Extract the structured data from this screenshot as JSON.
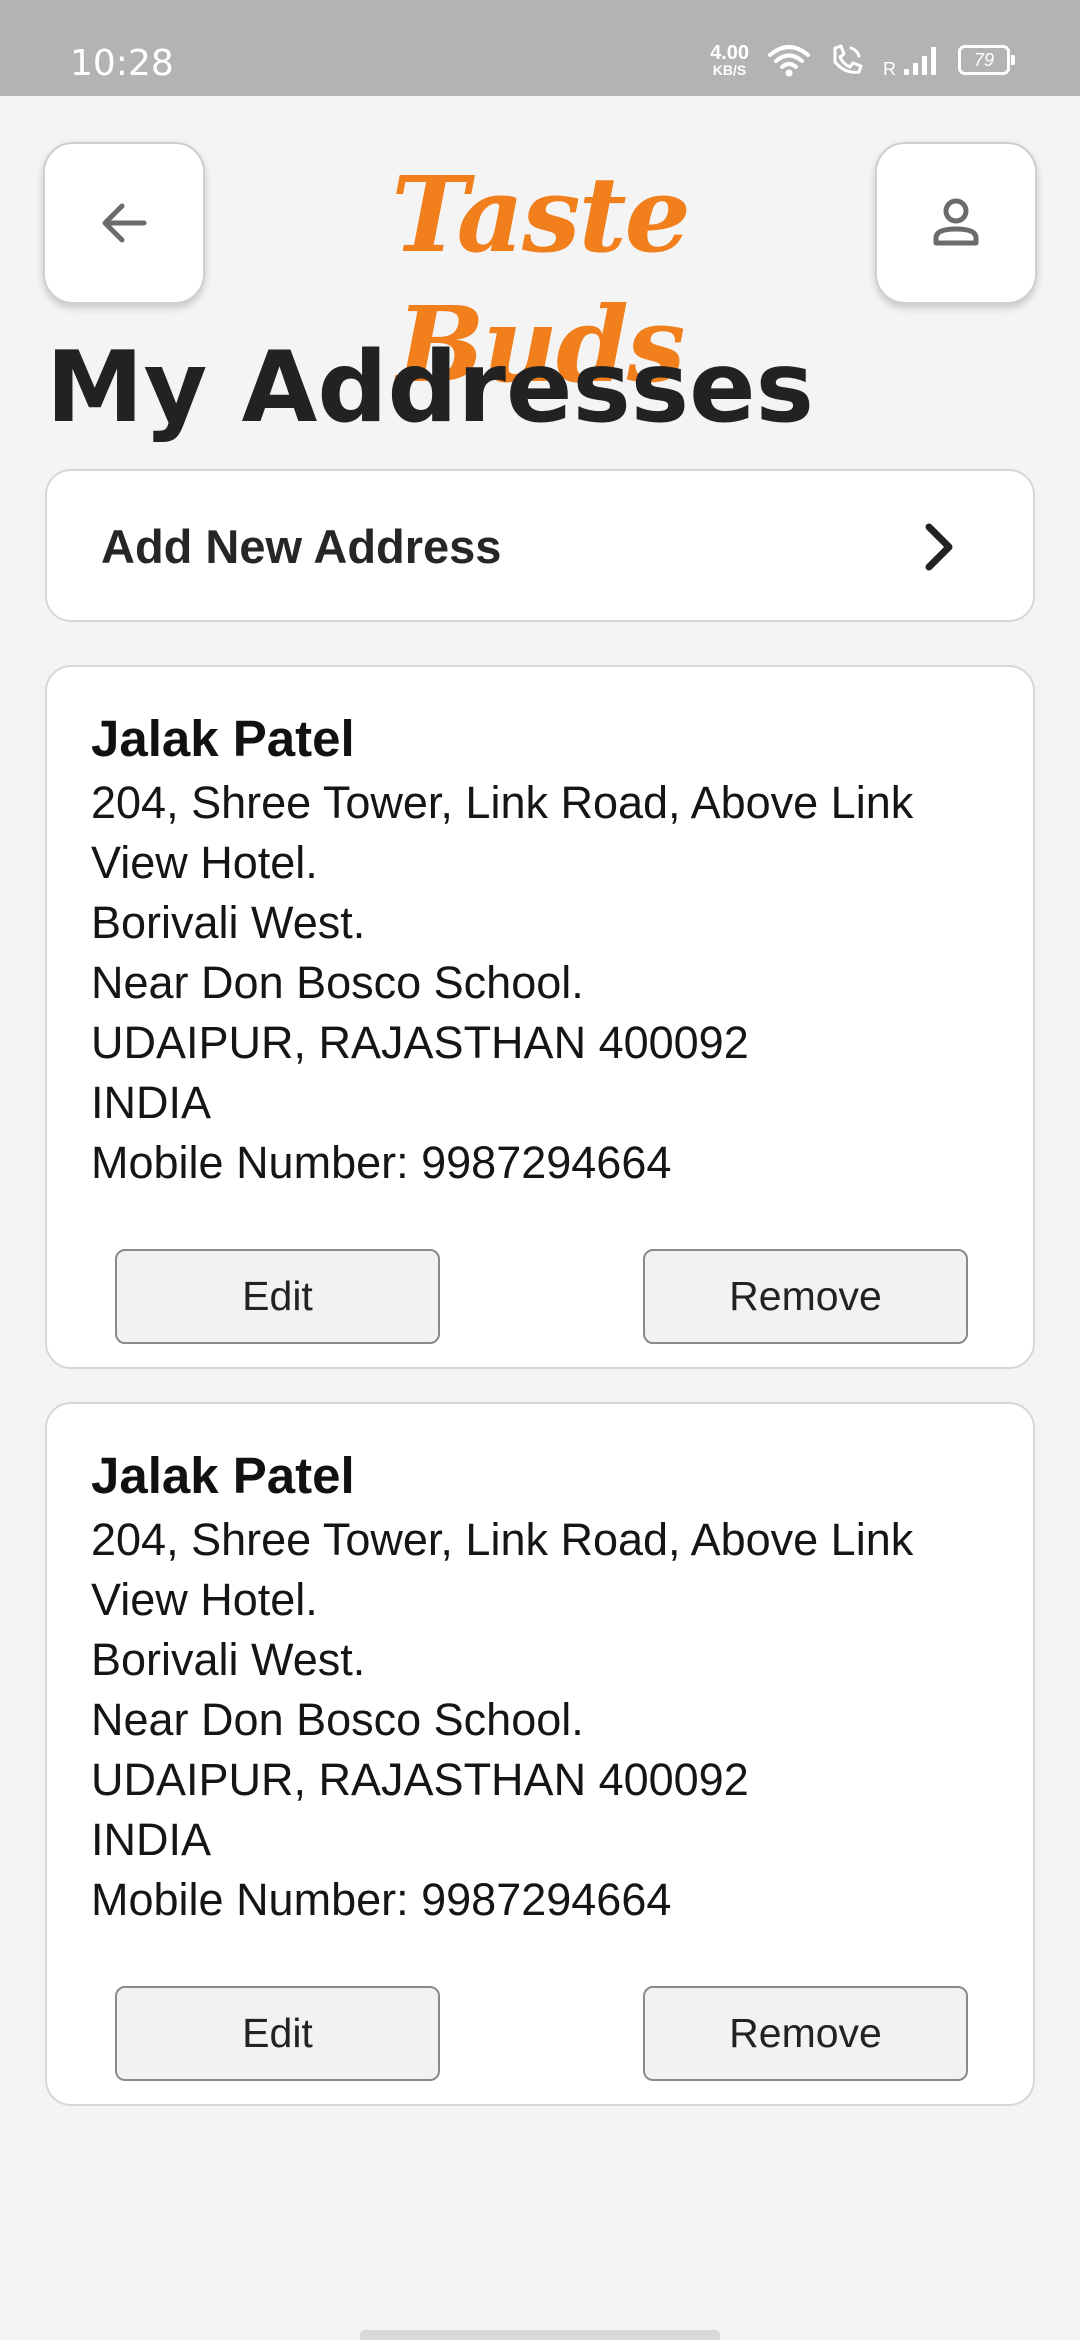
{
  "status_bar": {
    "time": "10:28",
    "net_speed_value": "4.00",
    "net_speed_unit": "KB/S",
    "signal_label": "R",
    "battery": "79",
    "icons": [
      "wifi-icon",
      "wifi-calling-icon",
      "signal-icon",
      "battery-icon"
    ]
  },
  "header": {
    "brand": "Taste Buds",
    "brand_color": "#f07f1c",
    "back_icon": "arrow-left-icon",
    "profile_icon": "person-icon"
  },
  "page": {
    "title": "My Addresses"
  },
  "add_address": {
    "label": "Add New Address",
    "icon": "chevron-right-icon"
  },
  "addresses": [
    {
      "name": "Jalak Patel",
      "lines": [
        "204, Shree Tower, Link Road, Above Link",
        "View Hotel.",
        "Borivali West.",
        "Near Don Bosco School.",
        "UDAIPUR, RAJASTHAN 400092",
        "INDIA",
        "Mobile Number: 9987294664"
      ],
      "edit_label": "Edit",
      "remove_label": "Remove"
    },
    {
      "name": "Jalak Patel",
      "lines": [
        "204, Shree Tower, Link Road, Above Link",
        "View Hotel.",
        "Borivali West.",
        "Near Don Bosco School.",
        "UDAIPUR, RAJASTHAN 400092",
        "INDIA",
        "Mobile Number: 9987294664"
      ],
      "edit_label": "Edit",
      "remove_label": "Remove"
    }
  ]
}
